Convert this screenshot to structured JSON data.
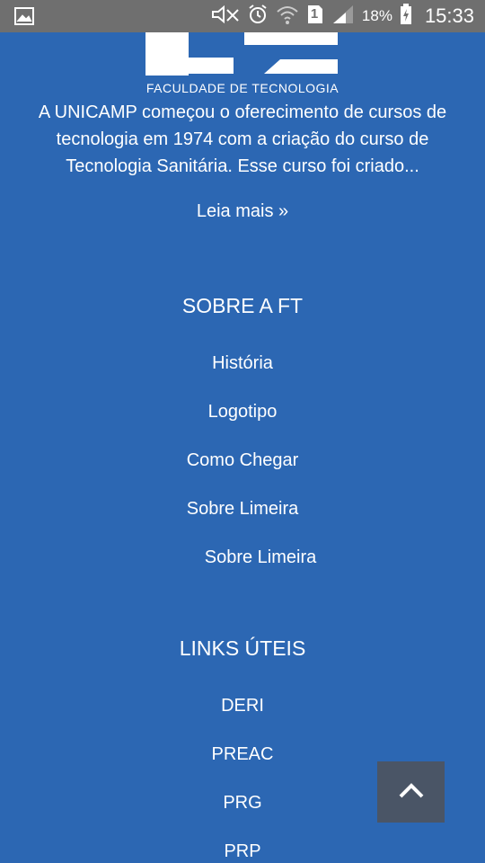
{
  "status_bar": {
    "battery_percent": "18%",
    "time": "15:33",
    "sim_slot": "1",
    "icons": [
      "image-icon",
      "mute-icon",
      "alarm-icon",
      "wifi-icon",
      "sim-icon",
      "signal-icon",
      "battery-charging-icon"
    ]
  },
  "logo": {
    "text": "FACULDADE DE TECNOLOGIA"
  },
  "intro": {
    "text": "A UNICAMP começou o oferecimento de cursos de tecnologia em 1974 com a criação do curso de Tecnologia Sanitária. Esse curso foi criado...",
    "read_more": "Leia mais »"
  },
  "about_section": {
    "title": "SOBRE A FT",
    "items": [
      "História",
      "Logotipo",
      "Como Chegar",
      "Sobre Limeira",
      "Sobre Limeira"
    ]
  },
  "links_section": {
    "title": "LINKS ÚTEIS",
    "items": [
      "DERI",
      "PREAC",
      "PRG",
      "PRP"
    ]
  },
  "back_to_top": {
    "icon": "chevron-up-icon"
  },
  "colors": {
    "background": "#2c67b3",
    "status_bar": "#6f6f6f",
    "back_to_top": "#4a5566"
  }
}
